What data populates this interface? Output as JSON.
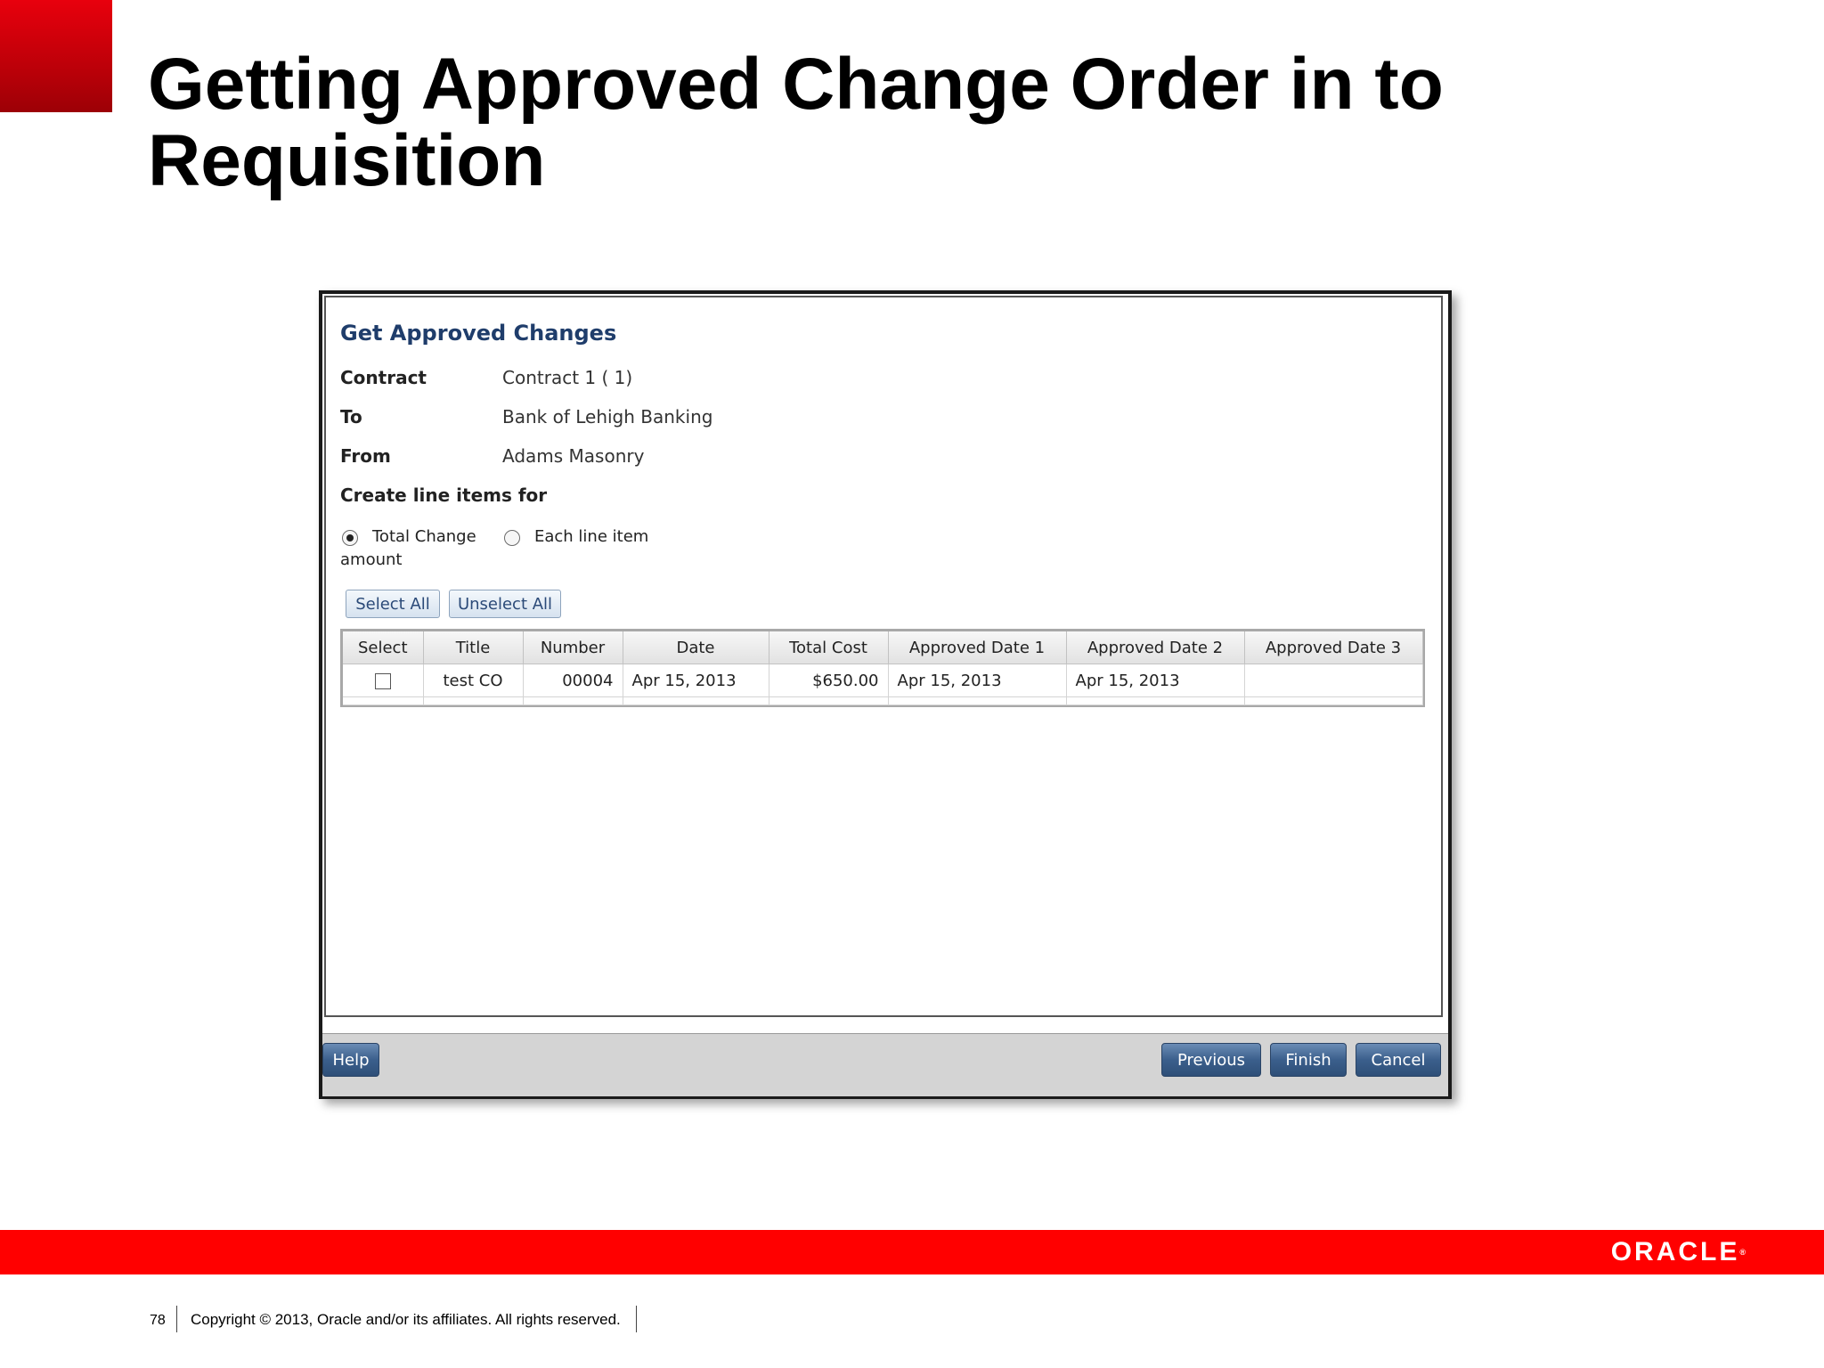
{
  "slide": {
    "title": "Getting Approved Change Order in to Requisition",
    "page_number": "78",
    "copyright": "Copyright © 2013, Oracle and/or its affiliates. All rights reserved.",
    "logo_text": "ORACLE"
  },
  "dialog": {
    "heading": "Get Approved Changes",
    "fields": [
      {
        "label": "Contract",
        "value": "Contract 1 ( 1)"
      },
      {
        "label": "To",
        "value": "Bank of Lehigh Banking"
      },
      {
        "label": "From",
        "value": "Adams Masonry"
      }
    ],
    "create_label": "Create line items for",
    "radio_options": [
      {
        "label": "Total Change",
        "label_line2": "amount",
        "checked": true
      },
      {
        "label": "Each line item",
        "checked": false
      }
    ],
    "select_all_label": "Select All",
    "unselect_all_label": "Unselect All",
    "table": {
      "columns": [
        "Select",
        "Title",
        "Number",
        "Date",
        "Total Cost",
        "Approved Date 1",
        "Approved Date 2",
        "Approved Date 3"
      ],
      "rows": [
        {
          "selected": false,
          "title": "test CO",
          "number": "00004",
          "date": "Apr 15, 2013",
          "total_cost": "$650.00",
          "approved_date_1": "Apr 15, 2013",
          "approved_date_2": "Apr 15, 2013",
          "approved_date_3": ""
        }
      ]
    },
    "footer": {
      "help_label": "Help",
      "previous_label": "Previous",
      "finish_label": "Finish",
      "cancel_label": "Cancel"
    }
  },
  "colors": {
    "brand_red": "#ff0000",
    "heading_blue": "#1f3d6b",
    "button_blue": "#3b5f8c"
  }
}
